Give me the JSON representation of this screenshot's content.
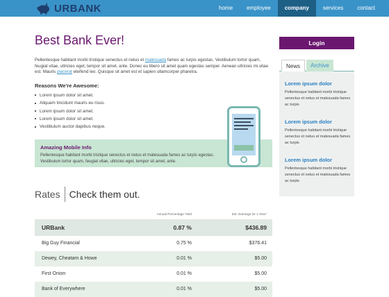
{
  "brand": {
    "name": "URBANK",
    "logo_icon": "piggy-bank-icon"
  },
  "nav": [
    {
      "label": "home",
      "active": false
    },
    {
      "label": "employee",
      "active": false
    },
    {
      "label": "company",
      "active": true
    },
    {
      "label": "services",
      "active": false
    },
    {
      "label": "contact",
      "active": false
    }
  ],
  "main": {
    "title": "Best Bank Ever!",
    "intro": {
      "part1": "Pellentesque habitant morbi tristique senectus et netus et ",
      "link1": "malesuada",
      "part2": " fames ac turpis egestas. Vestibulum tortor quam, feugiat vitae, ultricies eget, tempor sit amet, ante. Donec eu libero sit amet quam egestas semper. Aenean ultricies mi vitae est. Mauris ",
      "link2": "placerat",
      "part3": " eleifend leo. Quisque sit amet est et sapien ullamcorper pharetra."
    },
    "reasons_title": "Reasons We're Awesome:",
    "reasons": [
      "Lorem ipsum dolor sit amet.",
      "Aliquam tincidunt mauris eu risus.",
      "Lorem ipsum dolor sit amet.",
      "Lorem ipsum dolor sit amet.",
      "Vestibulum auctor dapibus neque."
    ],
    "mobile": {
      "title": "Amazing Mobile Info",
      "text": "Pellentesque habitant morbi tristique senectus et netus et malesuada fames ac turpis egestas. Vestibulum tortor quam, feugiat vitae, ultricies eget, tempor sit amet, ante."
    },
    "rates": {
      "label": "Rates",
      "subtitle": "Check them out.",
      "col_apy": "Annual Percentage Yield",
      "col_earn": "Est. Earnings for 1 Year*",
      "rows": [
        {
          "name": "URBank",
          "apy": "0.87 %",
          "earn": "$436.89"
        },
        {
          "name": "Big Guy Financial",
          "apy": "0.75 %",
          "earn": "$376.41"
        },
        {
          "name": "Dewey, Cheatam & Howe",
          "apy": "0.01 %",
          "earn": "$5.00"
        },
        {
          "name": "First Onion",
          "apy": "0.01 %",
          "earn": "$5.00"
        },
        {
          "name": "Bank of Everywhere",
          "apy": "0.01 %",
          "earn": "$5.00"
        }
      ]
    }
  },
  "sidebar": {
    "login_label": "Login",
    "tabs": [
      "News",
      "Archive"
    ],
    "news": [
      {
        "title": "Lorem ipsum dolor",
        "text": "Pellentesque habitant morbi tristique senectus et netus et malesuada fames ac turpis"
      },
      {
        "title": "Lorem ipsum dolor",
        "text": "Pellentesque habitant morbi tristique senectus et netus et malesuada fames ac turpis"
      },
      {
        "title": "Lorem ipsum dolor",
        "text": "Pellentesque habitant morbi tristique senectus et netus et malesuada fames ac turpis"
      }
    ]
  },
  "colors": {
    "header": "#3a93c8",
    "nav_active": "#1e5f86",
    "brand_purple": "#6b1770",
    "mint": "#c8e6d3",
    "link": "#2a7fc0"
  }
}
